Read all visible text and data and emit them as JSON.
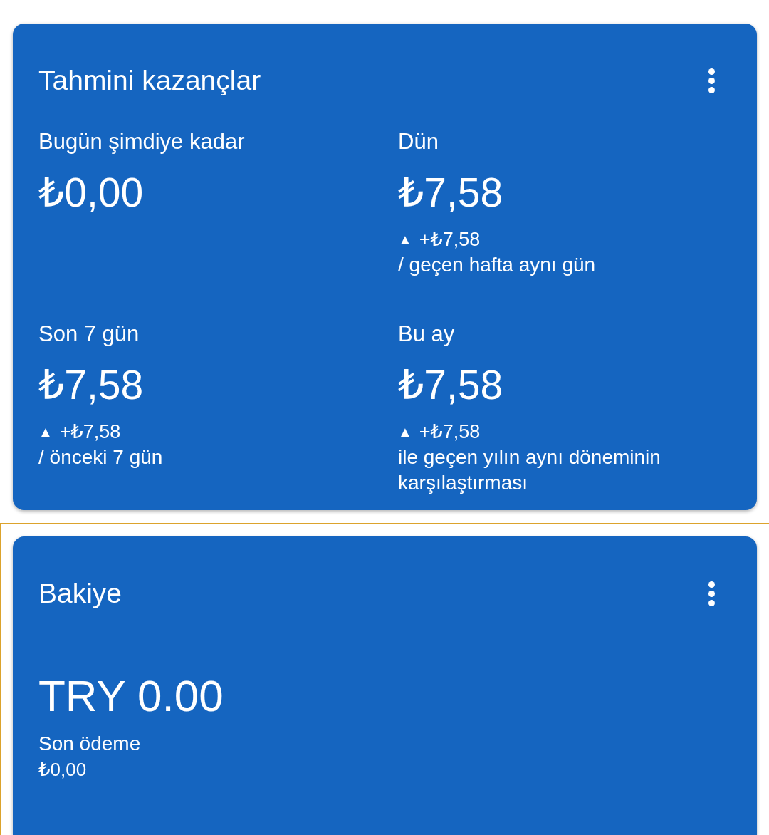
{
  "cards": [
    {
      "kind": "earnings",
      "title": "Tahmini kazançlar",
      "highlighted": false,
      "metrics": [
        {
          "label": "Bugün şimdiye kadar",
          "amount": "₺0,00"
        },
        {
          "label": "Dün",
          "amount": "₺7,58",
          "change": {
            "arrow": "▲",
            "value": "+₺7,58",
            "comparison": "/ geçen hafta aynı gün"
          }
        },
        {
          "label": "Son 7 gün",
          "amount": "₺7,58",
          "change": {
            "arrow": "▲",
            "value": "+₺7,58",
            "comparison": "/ önceki 7 gün"
          }
        },
        {
          "label": "Bu ay",
          "amount": "₺7,58",
          "change": {
            "arrow": "▲",
            "value": "+₺7,58",
            "comparison": "ile geçen yılın aynı döneminin karşılaştırması"
          }
        }
      ]
    },
    {
      "kind": "balance",
      "title": "Bakiye",
      "highlighted": true,
      "amount": "TRY 0.00",
      "last_payment": {
        "label": "Son ödeme",
        "value": "₺0,00"
      }
    }
  ]
}
